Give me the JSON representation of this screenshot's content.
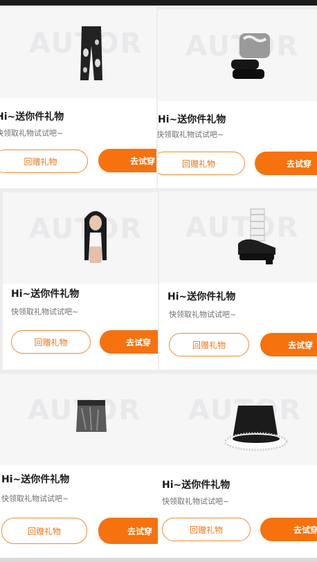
{
  "watermark_text": "AUTOR",
  "colors": {
    "accent": "#f5720f",
    "outline": "#f08b2e"
  },
  "cards": [
    {
      "item_icon": "ripped-jeans-item",
      "title": "Hi~送你件礼物",
      "subtitle": "快领取礼物试试吧~",
      "gift_back_label": "回赠礼物",
      "try_on_label": "去试穿"
    },
    {
      "item_icon": "platform-boots-item",
      "title": "Hi~送你件礼物",
      "subtitle": "快领取礼物试试吧~",
      "gift_back_label": "回赠礼物",
      "try_on_label": "去试穿"
    },
    {
      "item_icon": "long-hair-wig-item",
      "title": "Hi~送你件礼物",
      "subtitle": "快领取礼物试试吧~",
      "gift_back_label": "回赠礼物",
      "try_on_label": "去试穿"
    },
    {
      "item_icon": "mary-jane-shoes-item",
      "title": "Hi~送你件礼物",
      "subtitle": "快领取礼物试试吧~",
      "gift_back_label": "回赠礼物",
      "try_on_label": "去试穿"
    },
    {
      "item_icon": "denim-skirt-item",
      "title": "Hi~送你件礼物",
      "subtitle": "快领取礼物试试吧~",
      "gift_back_label": "回赠礼物",
      "try_on_label": "去试穿"
    },
    {
      "item_icon": "black-fur-skirt-item",
      "title": "Hi~送你件礼物",
      "subtitle": "快领取礼物试试吧~",
      "gift_back_label": "回赠礼物",
      "try_on_label": "去试穿"
    }
  ]
}
